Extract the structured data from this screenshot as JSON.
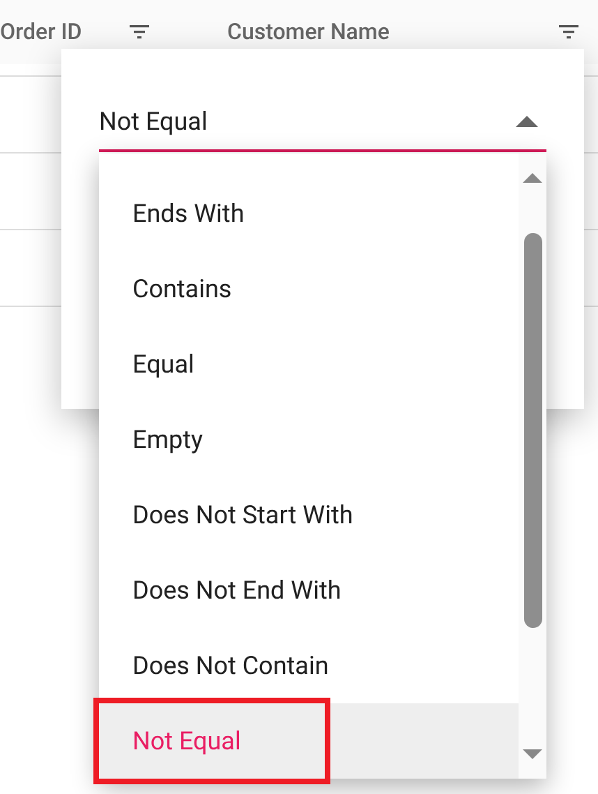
{
  "grid": {
    "columns": [
      {
        "label": "Order ID"
      },
      {
        "label": "Customer Name"
      }
    ]
  },
  "filter_dialog": {
    "operator_field": {
      "value": "Not Equal",
      "expanded": true
    },
    "options": [
      {
        "label": "Ends With",
        "selected": false
      },
      {
        "label": "Contains",
        "selected": false
      },
      {
        "label": "Equal",
        "selected": false
      },
      {
        "label": "Empty",
        "selected": false
      },
      {
        "label": "Does Not Start With",
        "selected": false
      },
      {
        "label": "Does Not End With",
        "selected": false
      },
      {
        "label": "Does Not Contain",
        "selected": false
      },
      {
        "label": "Not Equal",
        "selected": true
      }
    ]
  }
}
